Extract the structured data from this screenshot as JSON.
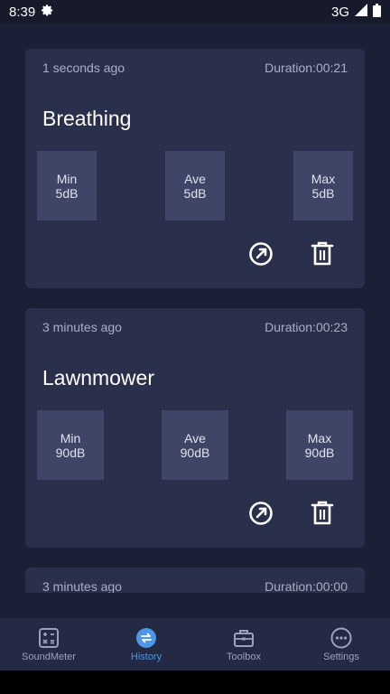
{
  "status_bar": {
    "time": "8:39",
    "network": "3G"
  },
  "cards": [
    {
      "time_ago": "1 seconds ago",
      "duration": "Duration:00:21",
      "title": "Breathing",
      "min_label": "Min",
      "min_value": "5dB",
      "ave_label": "Ave",
      "ave_value": "5dB",
      "max_label": "Max",
      "max_value": "5dB"
    },
    {
      "time_ago": "3 minutes ago",
      "duration": "Duration:00:23",
      "title": "Lawnmower",
      "min_label": "Min",
      "min_value": "90dB",
      "ave_label": "Ave",
      "ave_value": "90dB",
      "max_label": "Max",
      "max_value": "90dB"
    },
    {
      "time_ago": "3 minutes ago",
      "duration": "Duration:00:00"
    }
  ],
  "bottom_nav": {
    "items": [
      {
        "label": "SoundMeter",
        "icon": "calculator-icon"
      },
      {
        "label": "History",
        "icon": "swap-icon"
      },
      {
        "label": "Toolbox",
        "icon": "toolbox-icon"
      },
      {
        "label": "Settings",
        "icon": "more-icon"
      }
    ],
    "active_index": 1
  },
  "colors": {
    "background": "#1b2036",
    "card": "#2a304b",
    "stat_box": "#3e4566",
    "accent": "#4d96e8"
  }
}
